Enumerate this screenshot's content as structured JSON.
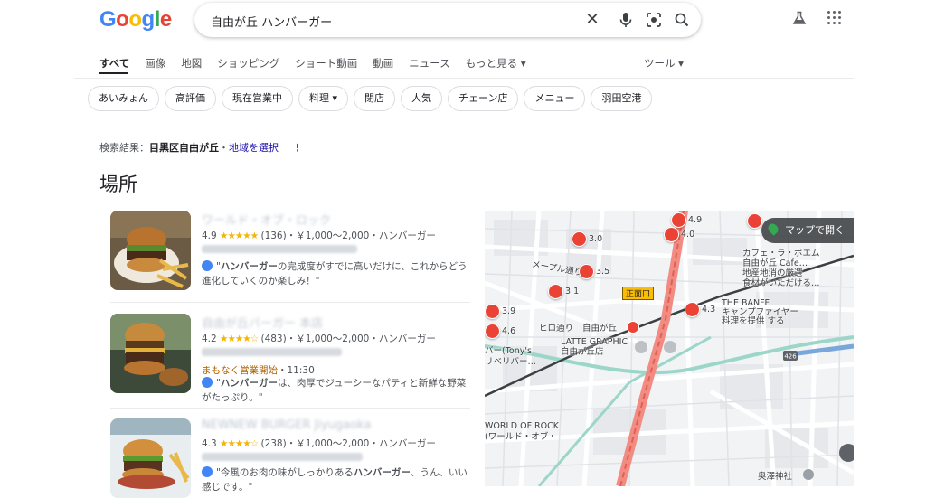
{
  "header": {
    "logo": [
      "G",
      "o",
      "o",
      "g",
      "l",
      "e"
    ],
    "query": "自由が丘 ハンバーガー",
    "icons": [
      "clear-icon",
      "mic-icon",
      "lens-icon",
      "search-icon",
      "labs-icon",
      "apps-icon"
    ]
  },
  "tabs": [
    "すべて",
    "画像",
    "地図",
    "ショッピング",
    "ショート動画",
    "動画",
    "ニュース",
    "もっと見る ▾"
  ],
  "tools_label": "ツール ▾",
  "chips": [
    "あいみょん",
    "高評価",
    "現在営業中",
    "料理 ▾",
    "閉店",
    "人気",
    "チェーン店",
    "メニュー",
    "羽田空港"
  ],
  "location": {
    "prefix": "検索結果：",
    "place": "目黒区自由が丘",
    "sep": "・",
    "link": "地域を選択",
    "more": "⋮"
  },
  "section_title": "場所",
  "results": [
    {
      "name": "ワールド・オブ・ロック",
      "rating": "4.9",
      "stars": "★★★★★",
      "meta": "(136)・￥1,000～2,000・ハンバーガー",
      "review_bold": "ハンバーガー",
      "review_pre": "\"",
      "review_post": "の完成度がすでに高いだけに、これからどう進化していくのか楽しみ！\""
    },
    {
      "name": "自由が丘バーガー 本店",
      "rating": "4.2",
      "stars": "★★★★☆",
      "meta": "(483)・￥1,000～2,000・ハンバーガー",
      "status": "まもなく営業開始",
      "status_time": "・11:30",
      "review_bold": "ハンバーガー",
      "review_pre": "\"",
      "review_post": "は、肉厚でジューシーなパティと新鮮な野菜がたっぷり。\""
    },
    {
      "name": "NEWNEW BURGER Jiyugaoka",
      "rating": "4.3",
      "stars": "★★★★☆",
      "meta": "(238)・￥1,000～2,000・ハンバーガー",
      "review_pre": "\"今風のお肉の味がしっかりある",
      "review_bold": "ハンバーガー",
      "review_post": "、うん、いい感じです。\""
    }
  ],
  "map": {
    "open_button": "マップで開く",
    "labels": {
      "station": "自由が丘",
      "station_exit": "正面口",
      "meple": "メープル通り",
      "hiro": "ヒロ通り",
      "latte": "LATTE GRAPHIC\n自由が丘店",
      "tonys": "バー(Tony's\nリベリバー…",
      "wor": "WORLD OF ROCK\n(ワールド・オブ・",
      "cafe": "カフェ・ラ・ボエム\n自由が丘 Cafe…\n地産地消の厳選\n食材がいただける…",
      "banff": "THE BANFF\nキャンプファイヤー\n料理を提供 する",
      "shrine": "奥澤神社",
      "route": "426"
    },
    "pins": [
      "4.9",
      "4.0",
      "3.0",
      "3.5",
      "3.1",
      "4.3",
      "3.9",
      "4.6"
    ]
  },
  "colors": {
    "blue": "#4285f4",
    "red": "#ea4335",
    "yellow": "#fbbc05",
    "green": "#34a853",
    "link": "#1a0dab",
    "star": "#f5b400",
    "open_soon": "#b06000"
  }
}
